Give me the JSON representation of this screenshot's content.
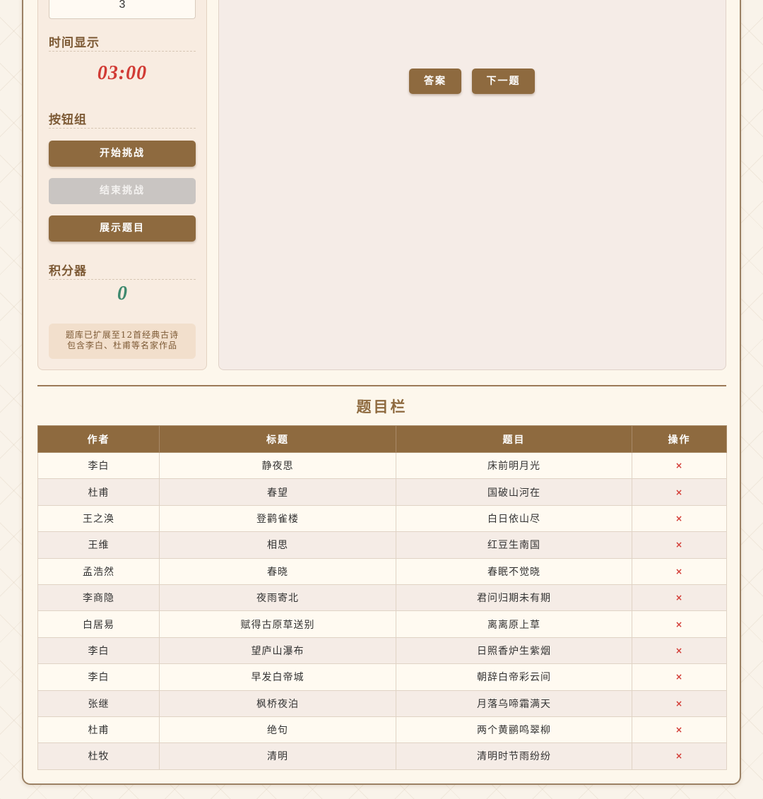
{
  "left": {
    "question_count": "3",
    "time_section_title": "时间显示",
    "timer": "03:00",
    "button_group_title": "按钮组",
    "start_button": "开始挑战",
    "end_button": "结束挑战",
    "show_button": "展示题目",
    "score_section_title": "积分器",
    "score": "0",
    "note_line1": "题库已扩展至12首经典古诗",
    "note_line2": "包含李白、杜甫等名家作品"
  },
  "right": {
    "answer_button": "答案",
    "next_button": "下一题"
  },
  "question_list": {
    "title": "题目栏",
    "headers": [
      "作者",
      "标题",
      "题目",
      "操作"
    ],
    "rows": [
      {
        "author": "李白",
        "title": "静夜思",
        "question": "床前明月光",
        "action": "×"
      },
      {
        "author": "杜甫",
        "title": "春望",
        "question": "国破山河在",
        "action": "×"
      },
      {
        "author": "王之涣",
        "title": "登鹳雀楼",
        "question": "白日依山尽",
        "action": "×"
      },
      {
        "author": "王维",
        "title": "相思",
        "question": "红豆生南国",
        "action": "×"
      },
      {
        "author": "孟浩然",
        "title": "春晓",
        "question": "春眠不觉晓",
        "action": "×"
      },
      {
        "author": "李商隐",
        "title": "夜雨寄北",
        "question": "君问归期未有期",
        "action": "×"
      },
      {
        "author": "白居易",
        "title": "赋得古原草送别",
        "question": "离离原上草",
        "action": "×"
      },
      {
        "author": "李白",
        "title": "望庐山瀑布",
        "question": "日照香炉生紫烟",
        "action": "×"
      },
      {
        "author": "李白",
        "title": "早发白帝城",
        "question": "朝辞白帝彩云间",
        "action": "×"
      },
      {
        "author": "张继",
        "title": "枫桥夜泊",
        "question": "月落乌啼霜满天",
        "action": "×"
      },
      {
        "author": "杜甫",
        "title": "绝句",
        "question": "两个黄鹂鸣翠柳",
        "action": "×"
      },
      {
        "author": "杜牧",
        "title": "清明",
        "question": "清明时节雨纷纷",
        "action": "×"
      }
    ]
  },
  "colors": {
    "accent_brown": "#8e6a3f",
    "timer_red": "#d13b35",
    "score_green": "#3f8a6f",
    "delete_red": "#d33c36",
    "disabled_gray": "#c9c5c2"
  }
}
